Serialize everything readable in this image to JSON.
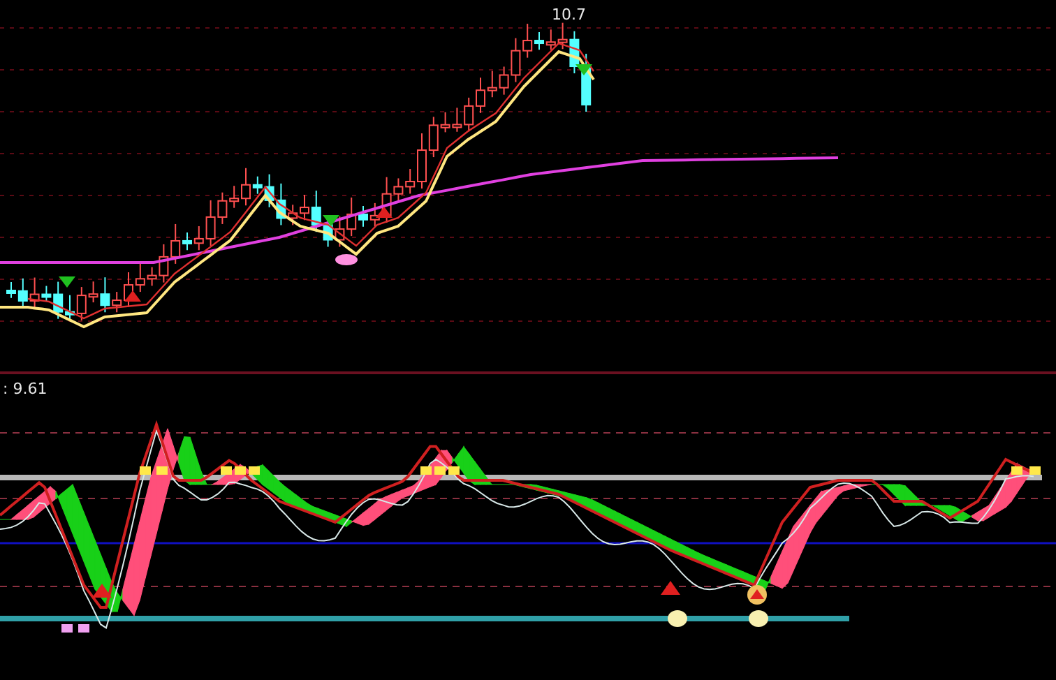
{
  "price_panel": {
    "high_label": "10.7"
  },
  "indicator_panel": {
    "value_label": ": 9.61"
  }
}
